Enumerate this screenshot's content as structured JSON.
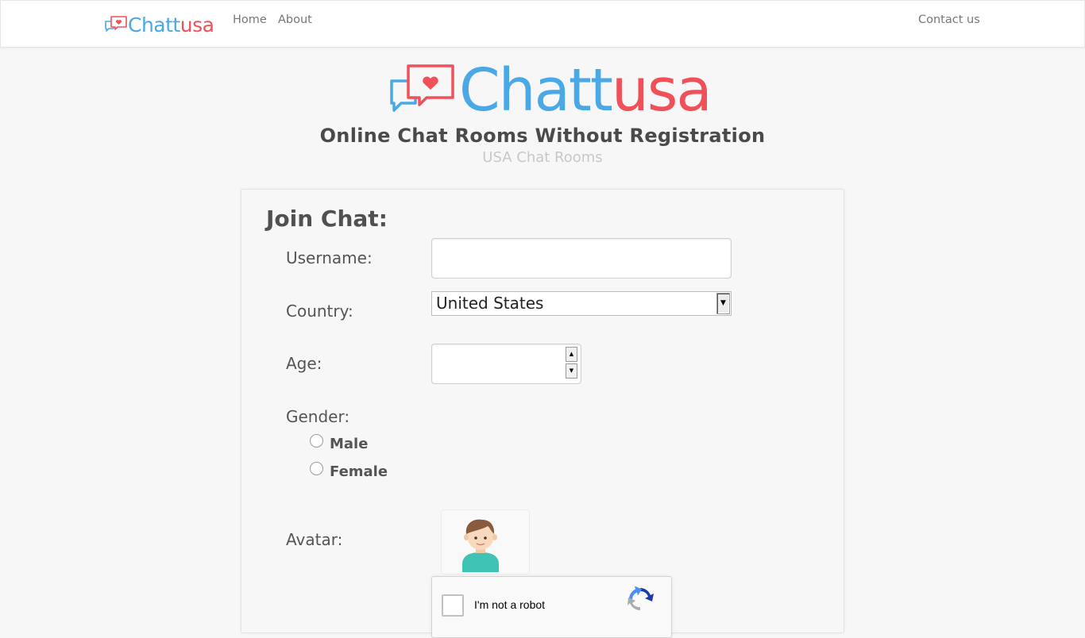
{
  "navbar": {
    "brand_part1": "Chatt",
    "brand_part2": "usa",
    "links": {
      "home": "Home",
      "about": "About",
      "contact": "Contact us"
    }
  },
  "hero": {
    "brand_part1": "Chatt",
    "brand_part2": "usa",
    "headline": "Online Chat Rooms Without Registration",
    "subheadline": "USA Chat Rooms"
  },
  "form": {
    "title": "Join Chat:",
    "username": {
      "label": "Username:",
      "value": ""
    },
    "country": {
      "label": "Country:",
      "value": "United States"
    },
    "age": {
      "label": "Age:",
      "value": ""
    },
    "gender": {
      "label": "Gender:",
      "options": [
        "Male",
        "Female"
      ],
      "selected": null
    },
    "avatar": {
      "label": "Avatar:"
    },
    "recaptcha": {
      "text": "I'm not a robot"
    }
  },
  "colors": {
    "brand_blue": "#4aa8e6",
    "brand_red": "#f0505a",
    "background": "#f7f7f7"
  },
  "icons": {
    "logo": "chat-bubbles-heart-icon",
    "avatar": "boy-avatar-icon",
    "recaptcha": "recaptcha-logo-icon",
    "select_arrow": "chevron-down-icon",
    "spin_up": "caret-up-icon",
    "spin_down": "caret-down-icon"
  }
}
